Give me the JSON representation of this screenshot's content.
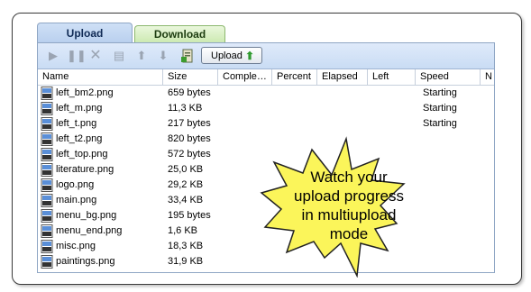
{
  "tabs": [
    {
      "label": "Upload",
      "active": true
    },
    {
      "label": "Download",
      "active": false
    }
  ],
  "toolbar": {
    "icons": [
      "play-icon",
      "pause-icon",
      "cancel-icon",
      "clear-icon",
      "move-up-icon",
      "move-down-icon",
      "add-files-icon"
    ],
    "upload_label": "Upload"
  },
  "columns": [
    "Name",
    "Size",
    "Comple…",
    "Percent",
    "Elapsed",
    "Left",
    "Speed",
    "N"
  ],
  "files": [
    {
      "name": "left_bm2.png",
      "size": "659 bytes",
      "speed": "Starting"
    },
    {
      "name": "left_m.png",
      "size": "11,3 KB",
      "speed": "Starting"
    },
    {
      "name": "left_t.png",
      "size": "217 bytes",
      "speed": "Starting"
    },
    {
      "name": "left_t2.png",
      "size": "820 bytes",
      "speed": ""
    },
    {
      "name": "left_top.png",
      "size": "572 bytes",
      "speed": ""
    },
    {
      "name": "literature.png",
      "size": "25,0 KB",
      "speed": ""
    },
    {
      "name": "logo.png",
      "size": "29,2 KB",
      "speed": ""
    },
    {
      "name": "main.png",
      "size": "33,4 KB",
      "speed": ""
    },
    {
      "name": "menu_bg.png",
      "size": "195 bytes",
      "speed": ""
    },
    {
      "name": "menu_end.png",
      "size": "1,6 KB",
      "speed": ""
    },
    {
      "name": "misc.png",
      "size": "18,3 KB",
      "speed": ""
    },
    {
      "name": "paintings.png",
      "size": "31,9 KB",
      "speed": ""
    }
  ],
  "callout": {
    "lines": [
      "Watch your",
      "upload progress",
      "in multiupload",
      "mode"
    ],
    "fill": "#fbf55a",
    "stroke": "#222222"
  }
}
